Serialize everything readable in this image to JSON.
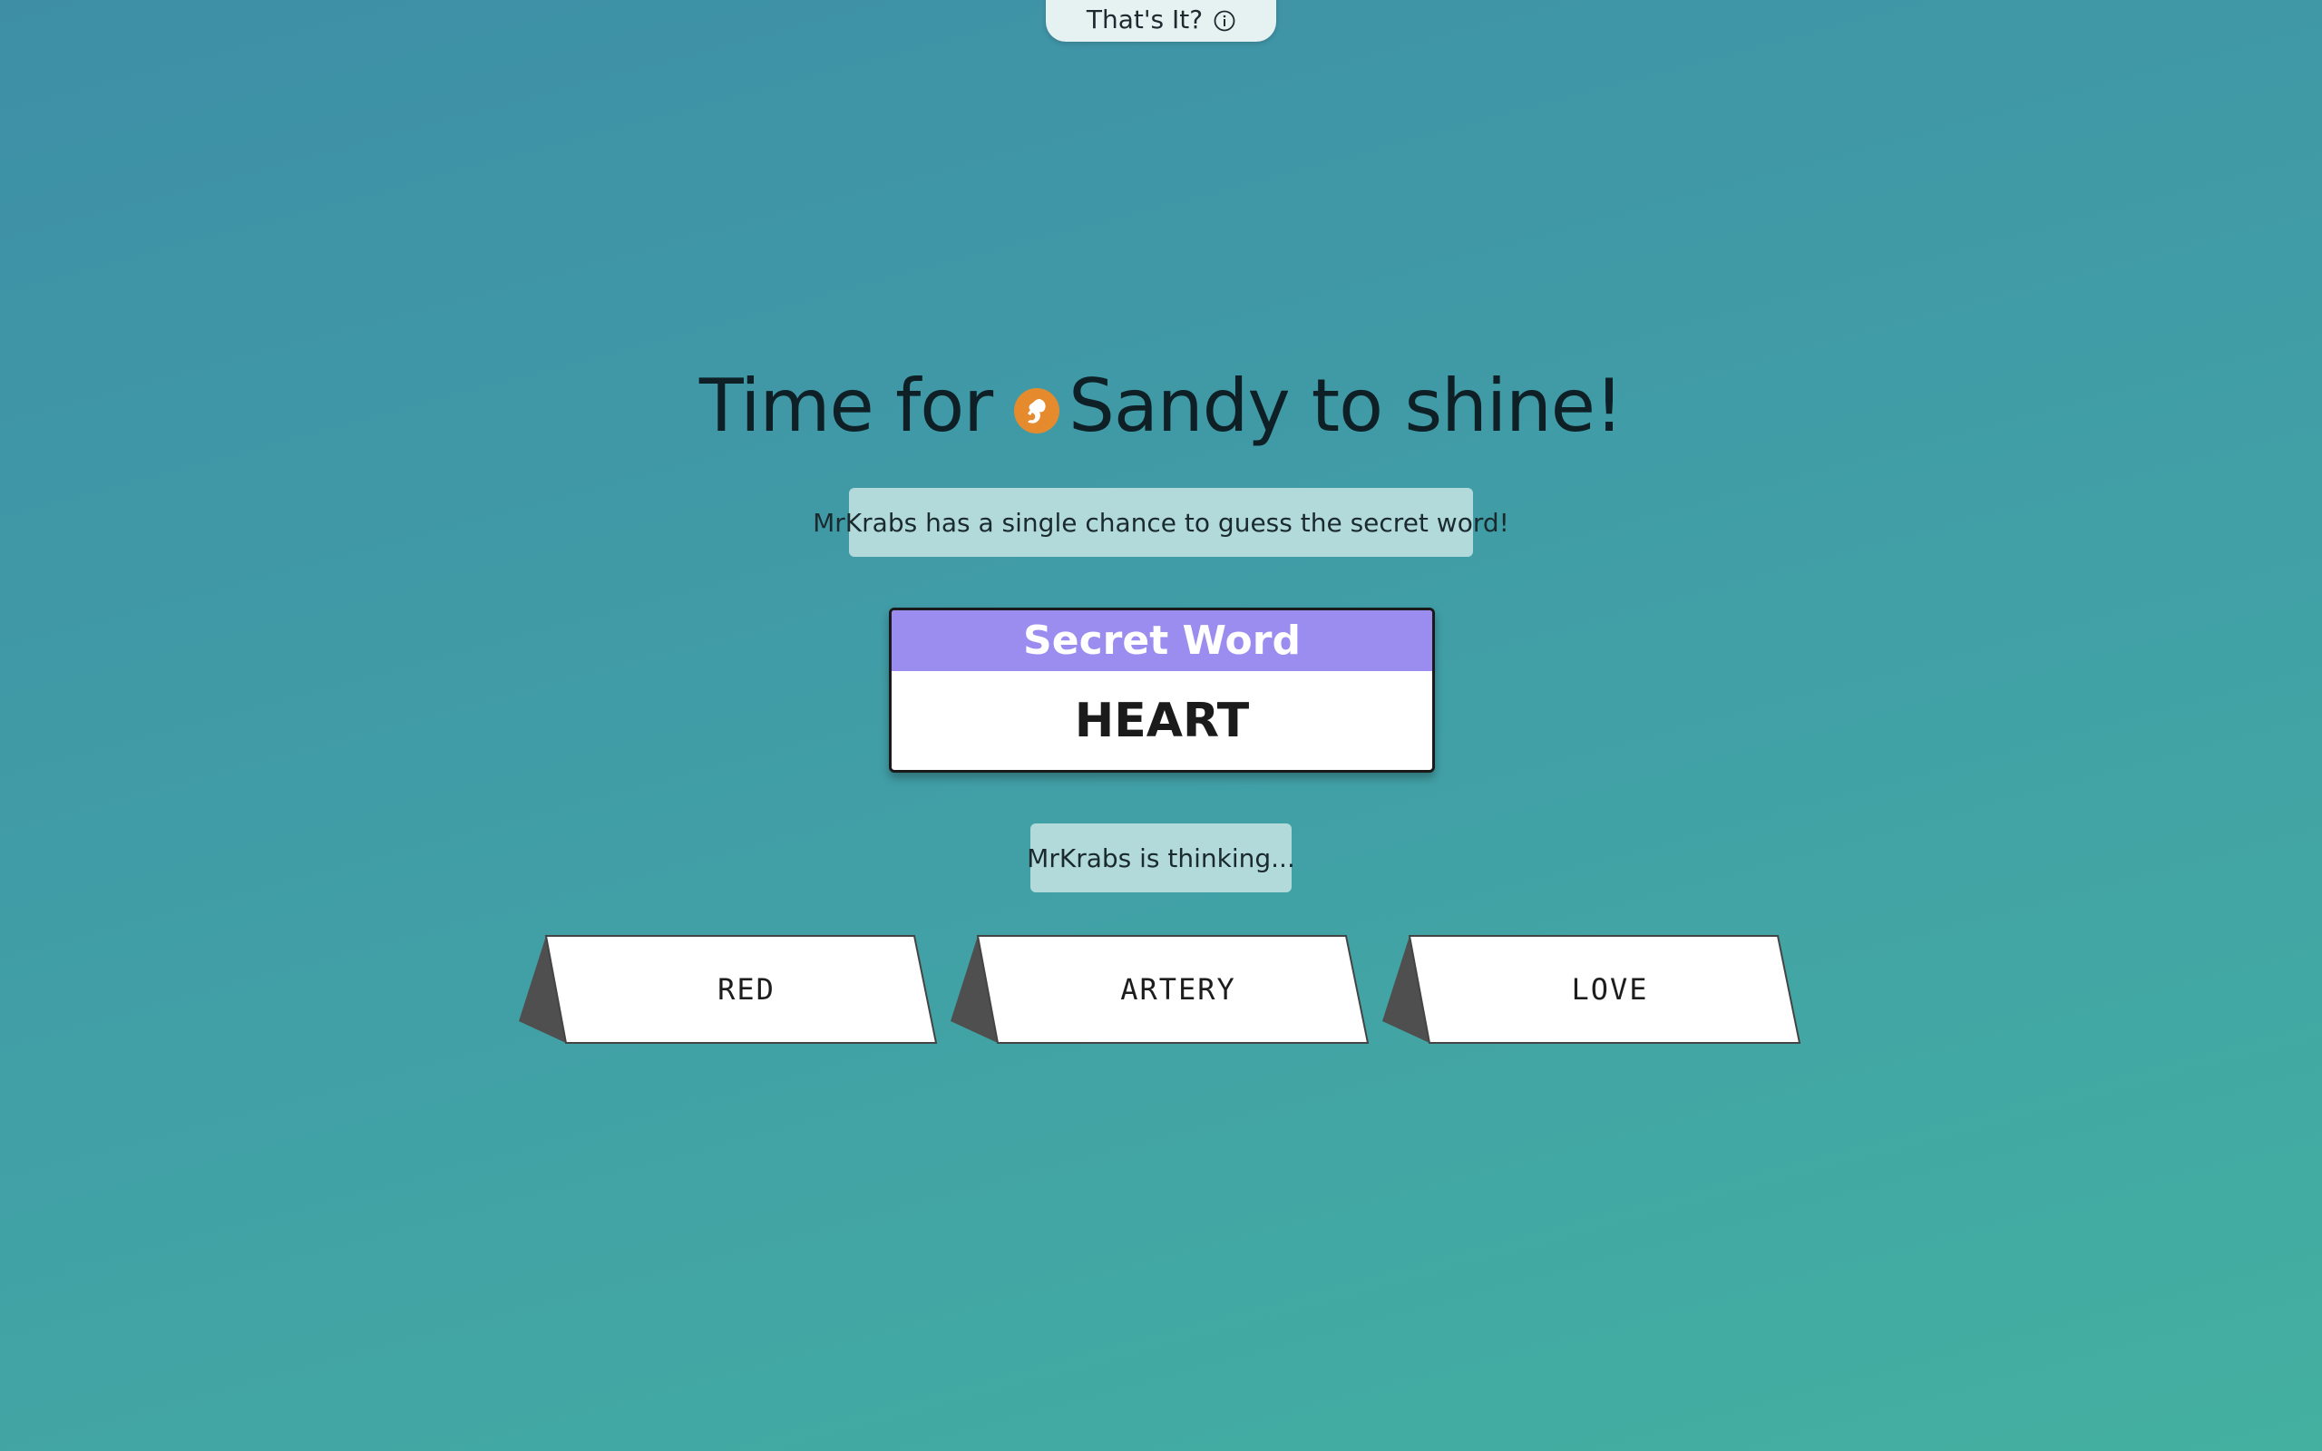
{
  "top_pill": {
    "label": "That's It?",
    "icon": "info-icon"
  },
  "headline": {
    "prefix": "Time for",
    "player": "Sandy",
    "suffix": "to shine!",
    "avatar_icon": "squirrel-avatar-icon",
    "avatar_color": "#e58b2e"
  },
  "status": {
    "chance_message": "MrKrabs has a single chance to guess the secret word!",
    "thinking_message": "MrKrabs is thinking..."
  },
  "secret_card": {
    "header": "Secret Word",
    "word": "HEART",
    "header_color": "#9b8cf0"
  },
  "clues": [
    {
      "word": "RED"
    },
    {
      "word": "ARTERY"
    },
    {
      "word": "LOVE"
    }
  ]
}
